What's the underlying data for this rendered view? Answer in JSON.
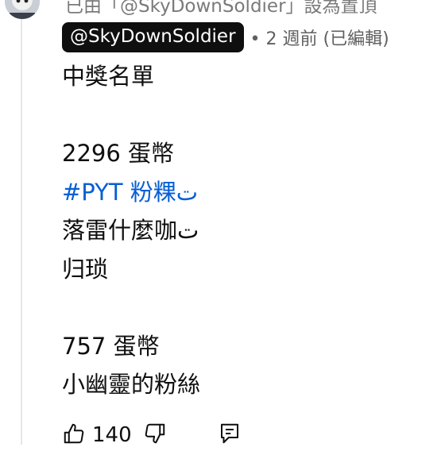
{
  "top_strip": {
    "text": "已由「@SkyDownSoldier」設為置頂"
  },
  "comment": {
    "author_mention": "@SkyDownSoldier",
    "meta": "• 2 週前 (已編輯)",
    "lines": [
      {
        "text": "中獎名單",
        "type": "text"
      },
      {
        "text": "",
        "type": "blank"
      },
      {
        "text": "2296 蛋幣",
        "type": "text"
      },
      {
        "text": "#PYT 粉粿ت",
        "type": "hashtag"
      },
      {
        "text": "落雷什麼咖ت",
        "type": "text"
      },
      {
        "text": "归琐",
        "type": "text"
      },
      {
        "text": "",
        "type": "blank"
      },
      {
        "text": "757 蛋幣",
        "type": "text"
      },
      {
        "text": "小幽靈的粉絲",
        "type": "text"
      }
    ]
  },
  "actions": {
    "like_count": "140",
    "icons": [
      "thumbs-up-icon",
      "thumbs-down-icon",
      "reply-icon"
    ]
  }
}
